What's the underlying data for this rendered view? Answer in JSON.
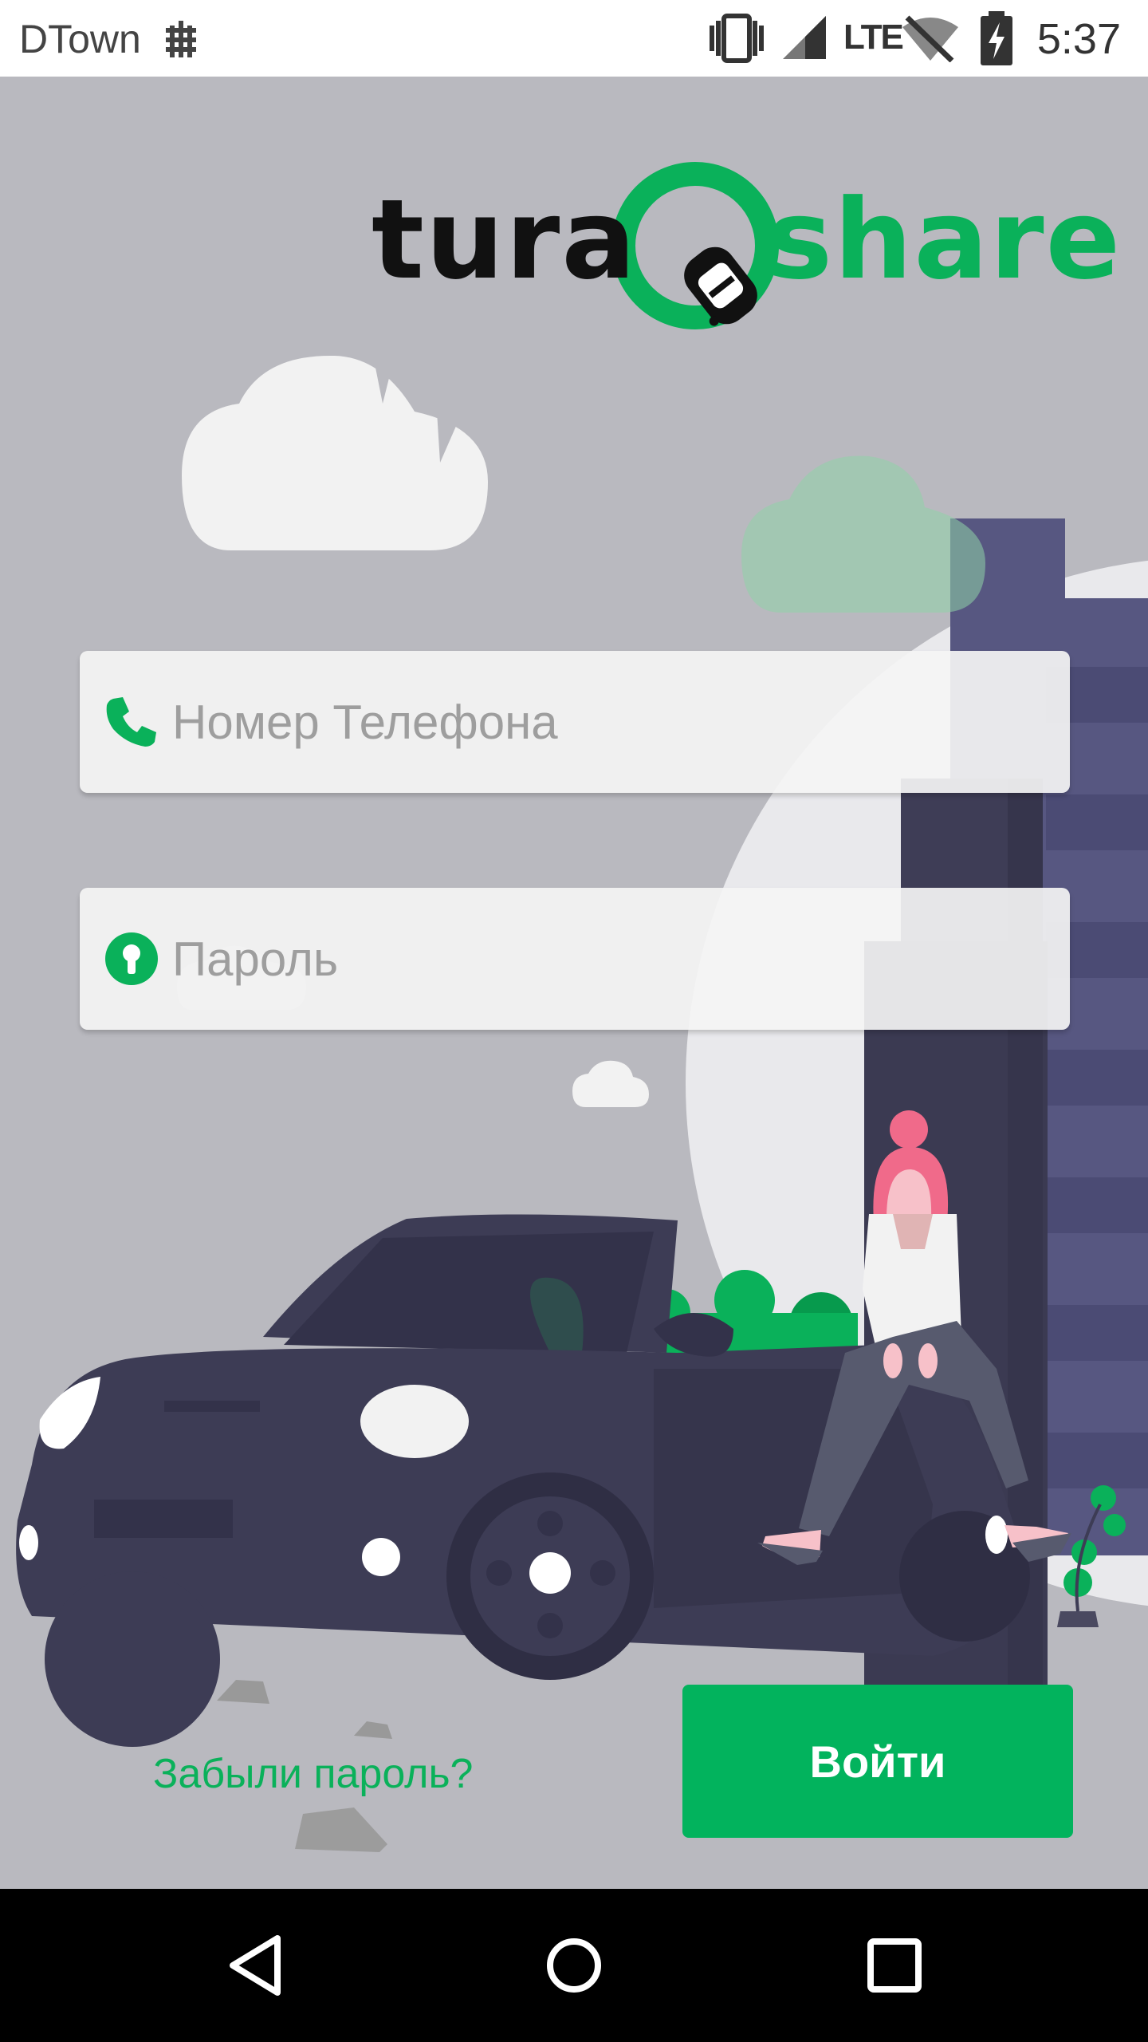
{
  "status_bar": {
    "carrier": "DTown",
    "network": "LTE",
    "time": "5:37",
    "icons": [
      "dtown-network-icon",
      "vibrate-icon",
      "signal-icon",
      "wifi-off-icon",
      "battery-charging-icon"
    ]
  },
  "logo": {
    "part1": "tura",
    "part2": "share",
    "icon": "car-in-ring-icon"
  },
  "phone": {
    "placeholder": "Номер Телефона",
    "value": "",
    "icon": "phone-icon"
  },
  "password": {
    "placeholder": "Пароль",
    "value": "",
    "icon": "keyhole-icon"
  },
  "forgot_password": "Забыли пароль?",
  "login_button": "Войти",
  "nav": {
    "icons": [
      "back-icon",
      "home-icon",
      "recents-icon"
    ]
  },
  "colors": {
    "accent": "#02b35d",
    "background": "#b9b9bf",
    "field": "#f4f4f4",
    "logo_dark": "#111111"
  }
}
